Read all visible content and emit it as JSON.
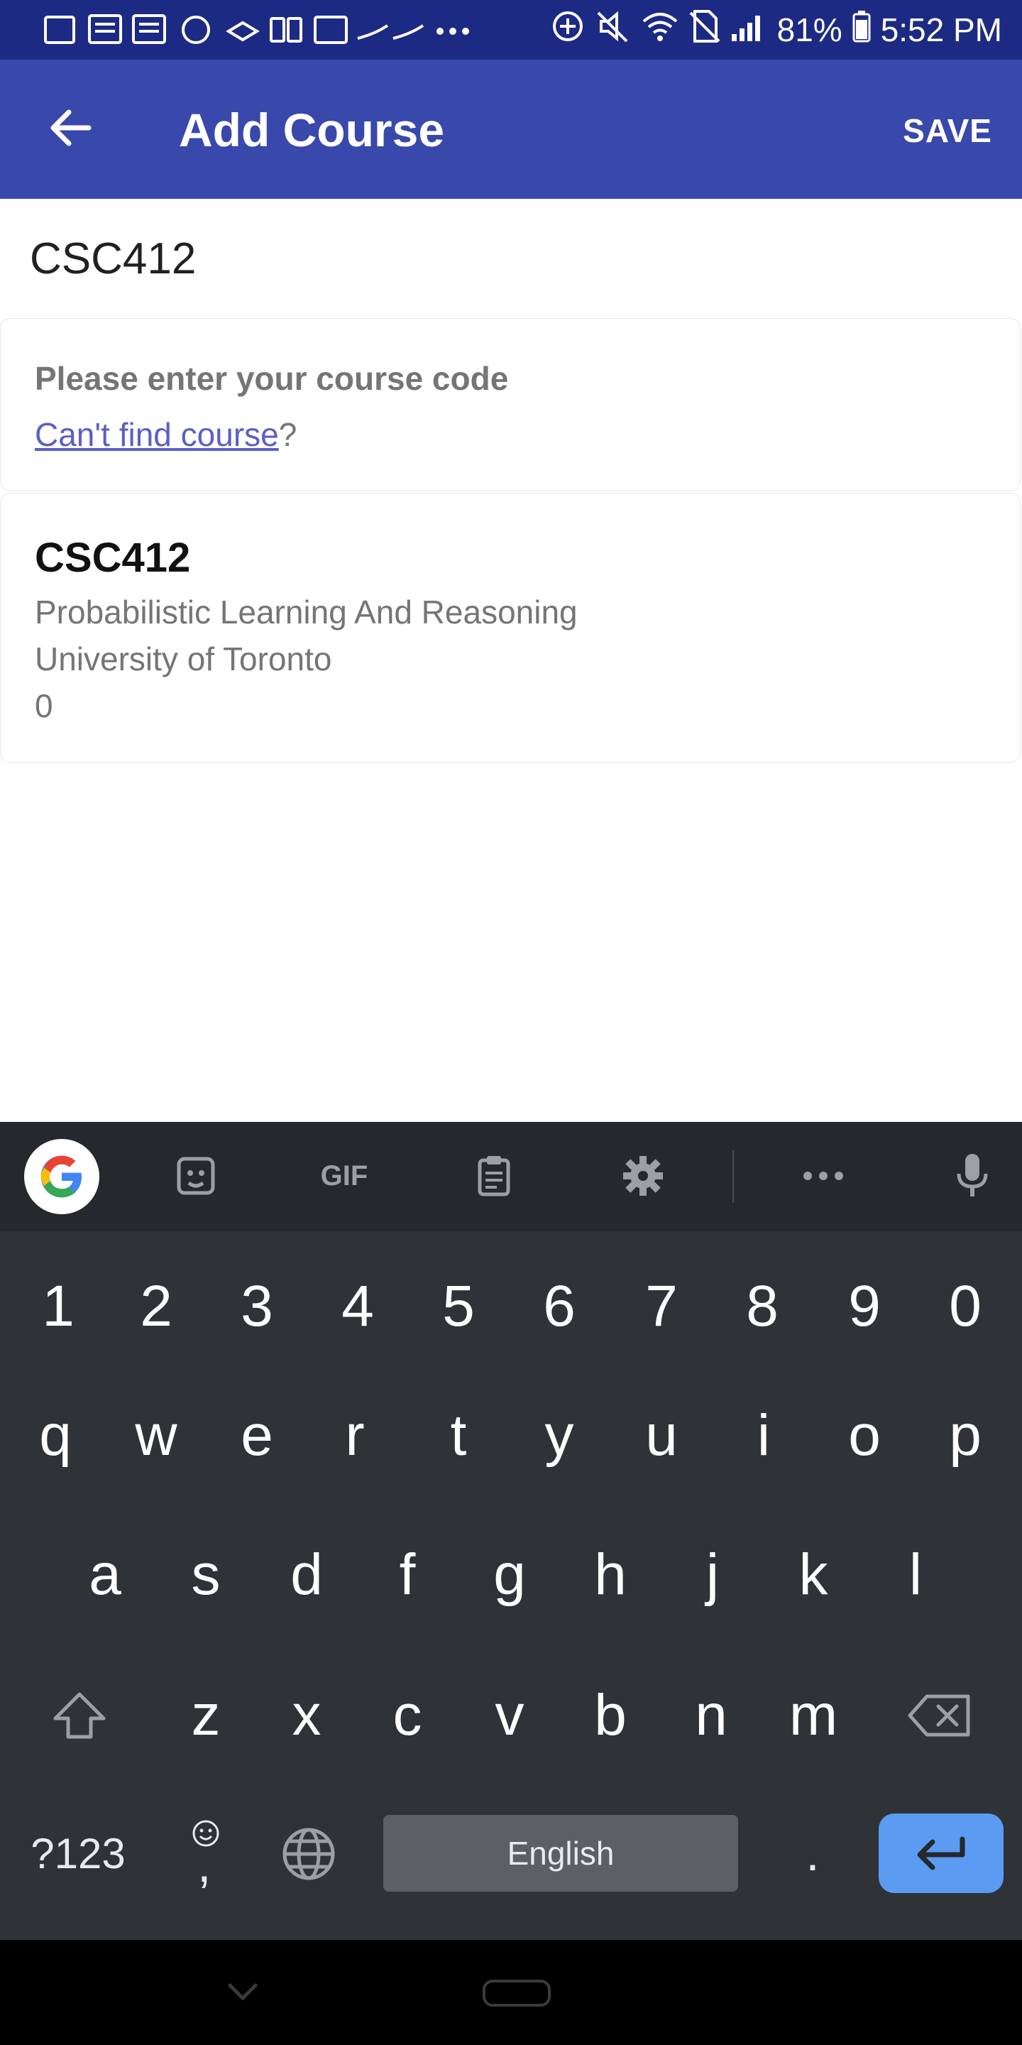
{
  "status_bar": {
    "battery": "81%",
    "time": "5:52 PM"
  },
  "app_bar": {
    "title": "Add Course",
    "save_label": "SAVE"
  },
  "search": {
    "value": "CSC412"
  },
  "hint": {
    "text": "Please enter your course code",
    "link_text": "Can't find course",
    "link_suffix": "?"
  },
  "result": {
    "code": "CSC412",
    "name": "Probabilistic Learning And Reasoning",
    "university": "University of Toronto",
    "count": "0"
  },
  "keyboard": {
    "toolbar_gif": "GIF",
    "number_row": [
      "1",
      "2",
      "3",
      "4",
      "5",
      "6",
      "7",
      "8",
      "9",
      "0"
    ],
    "row1": [
      "q",
      "w",
      "e",
      "r",
      "t",
      "y",
      "u",
      "i",
      "o",
      "p"
    ],
    "row2": [
      "a",
      "s",
      "d",
      "f",
      "g",
      "h",
      "j",
      "k",
      "l"
    ],
    "row3": [
      "z",
      "x",
      "c",
      "v",
      "b",
      "n",
      "m"
    ],
    "symbols_label": "?123",
    "comma": ",",
    "space_label": "English",
    "period": ".",
    "accent_color": "#5b9cf2"
  },
  "colors": {
    "status_bar": "#1d2a83",
    "app_bar": "#3948ab",
    "link": "#5b5fc7"
  }
}
